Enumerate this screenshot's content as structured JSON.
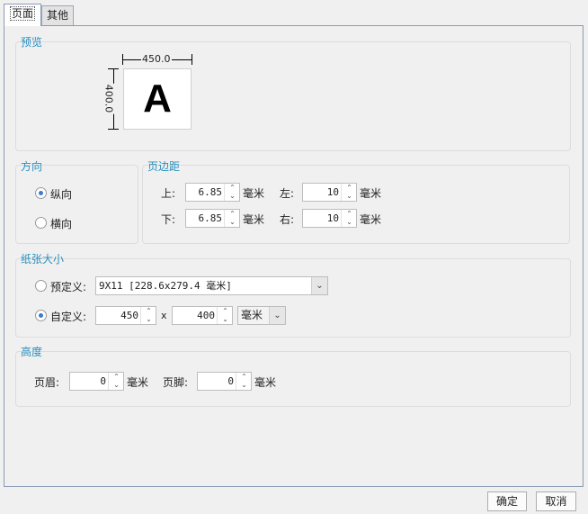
{
  "tabs": [
    {
      "label": "页面",
      "active": true
    },
    {
      "label": "其他",
      "active": false
    }
  ],
  "preview": {
    "title": "预览",
    "width_label": "450.0",
    "height_label": "400.0",
    "sample_letter": "A"
  },
  "orientation": {
    "title": "方向",
    "options": [
      {
        "label": "纵向",
        "checked": true
      },
      {
        "label": "横向",
        "checked": false
      }
    ]
  },
  "margins": {
    "title": "页边距",
    "top": {
      "label": "上:",
      "value": "6.85",
      "unit": "毫米"
    },
    "left": {
      "label": "左:",
      "value": "10",
      "unit": "毫米"
    },
    "bottom": {
      "label": "下:",
      "value": "6.85",
      "unit": "毫米"
    },
    "right": {
      "label": "右:",
      "value": "10",
      "unit": "毫米"
    }
  },
  "paper_size": {
    "title": "纸张大小",
    "predefined": {
      "label": "预定义:",
      "checked": false,
      "value": "9X11 [228.6x279.4 毫米]"
    },
    "custom": {
      "label": "自定义:",
      "checked": true,
      "width": "450",
      "times": "x",
      "height": "400",
      "unit": "毫米"
    }
  },
  "height_section": {
    "title": "高度",
    "header": {
      "label": "页眉:",
      "value": "0",
      "unit": "毫米"
    },
    "footer": {
      "label": "页脚:",
      "value": "0",
      "unit": "毫米"
    }
  },
  "buttons": {
    "ok": "确定",
    "cancel": "取消"
  },
  "colors": {
    "accent": "#2a8fbd",
    "radio_checked": "#3a7bd5",
    "border": "#8a9bb3"
  }
}
